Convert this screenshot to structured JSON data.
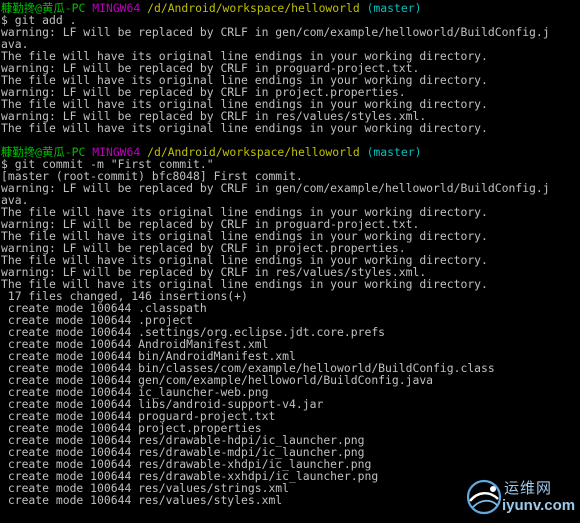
{
  "terminal": {
    "blocks": [
      {
        "prompt": {
          "user": "糠勤搀@黄瓜-PC",
          "system": "MINGW64",
          "path": "/d/Android/workspace/helloworld",
          "branch": "(master)"
        },
        "command": "$ git add .",
        "output": [
          "warning: LF will be replaced by CRLF in gen/com/example/helloworld/BuildConfig.j",
          "ava.",
          "The file will have its original line endings in your working directory.",
          "warning: LF will be replaced by CRLF in proguard-project.txt.",
          "The file will have its original line endings in your working directory.",
          "warning: LF will be replaced by CRLF in project.properties.",
          "The file will have its original line endings in your working directory.",
          "warning: LF will be replaced by CRLF in res/values/styles.xml.",
          "The file will have its original line endings in your working directory."
        ]
      },
      {
        "prompt": {
          "user": "糠勤搀@黄瓜-PC",
          "system": "MINGW64",
          "path": "/d/Android/workspace/helloworld",
          "branch": "(master)"
        },
        "command": "$ git commit -m \"First commit.\"",
        "output": [
          "[master (root-commit) bfc8048] First commit.",
          "warning: LF will be replaced by CRLF in gen/com/example/helloworld/BuildConfig.j",
          "ava.",
          "The file will have its original line endings in your working directory.",
          "warning: LF will be replaced by CRLF in proguard-project.txt.",
          "The file will have its original line endings in your working directory.",
          "warning: LF will be replaced by CRLF in project.properties.",
          "The file will have its original line endings in your working directory.",
          "warning: LF will be replaced by CRLF in res/values/styles.xml.",
          "The file will have its original line endings in your working directory.",
          " 17 files changed, 146 insertions(+)",
          " create mode 100644 .classpath",
          " create mode 100644 .project",
          " create mode 100644 .settings/org.eclipse.jdt.core.prefs",
          " create mode 100644 AndroidManifest.xml",
          " create mode 100644 bin/AndroidManifest.xml",
          " create mode 100644 bin/classes/com/example/helloworld/BuildConfig.class",
          " create mode 100644 gen/com/example/helloworld/BuildConfig.java",
          " create mode 100644 ic_launcher-web.png",
          " create mode 100644 libs/android-support-v4.jar",
          " create mode 100644 proguard-project.txt",
          " create mode 100644 project.properties",
          " create mode 100644 res/drawable-hdpi/ic_launcher.png",
          " create mode 100644 res/drawable-mdpi/ic_launcher.png",
          " create mode 100644 res/drawable-xhdpi/ic_launcher.png",
          " create mode 100644 res/drawable-xxhdpi/ic_launcher.png",
          " create mode 100644 res/values/strings.xml",
          " create mode 100644 res/values/styles.xml"
        ]
      }
    ]
  },
  "watermark": {
    "name": "运维网",
    "url": "iyunv.com",
    "icon": "globe-logo-icon"
  },
  "colors": {
    "background": "#000000",
    "text": "#c0c0c0",
    "prompt_user": "#00c000",
    "prompt_system": "#c000c0",
    "prompt_path": "#c0c000",
    "prompt_branch": "#00c0c0",
    "watermark": "#9fc9ea"
  }
}
